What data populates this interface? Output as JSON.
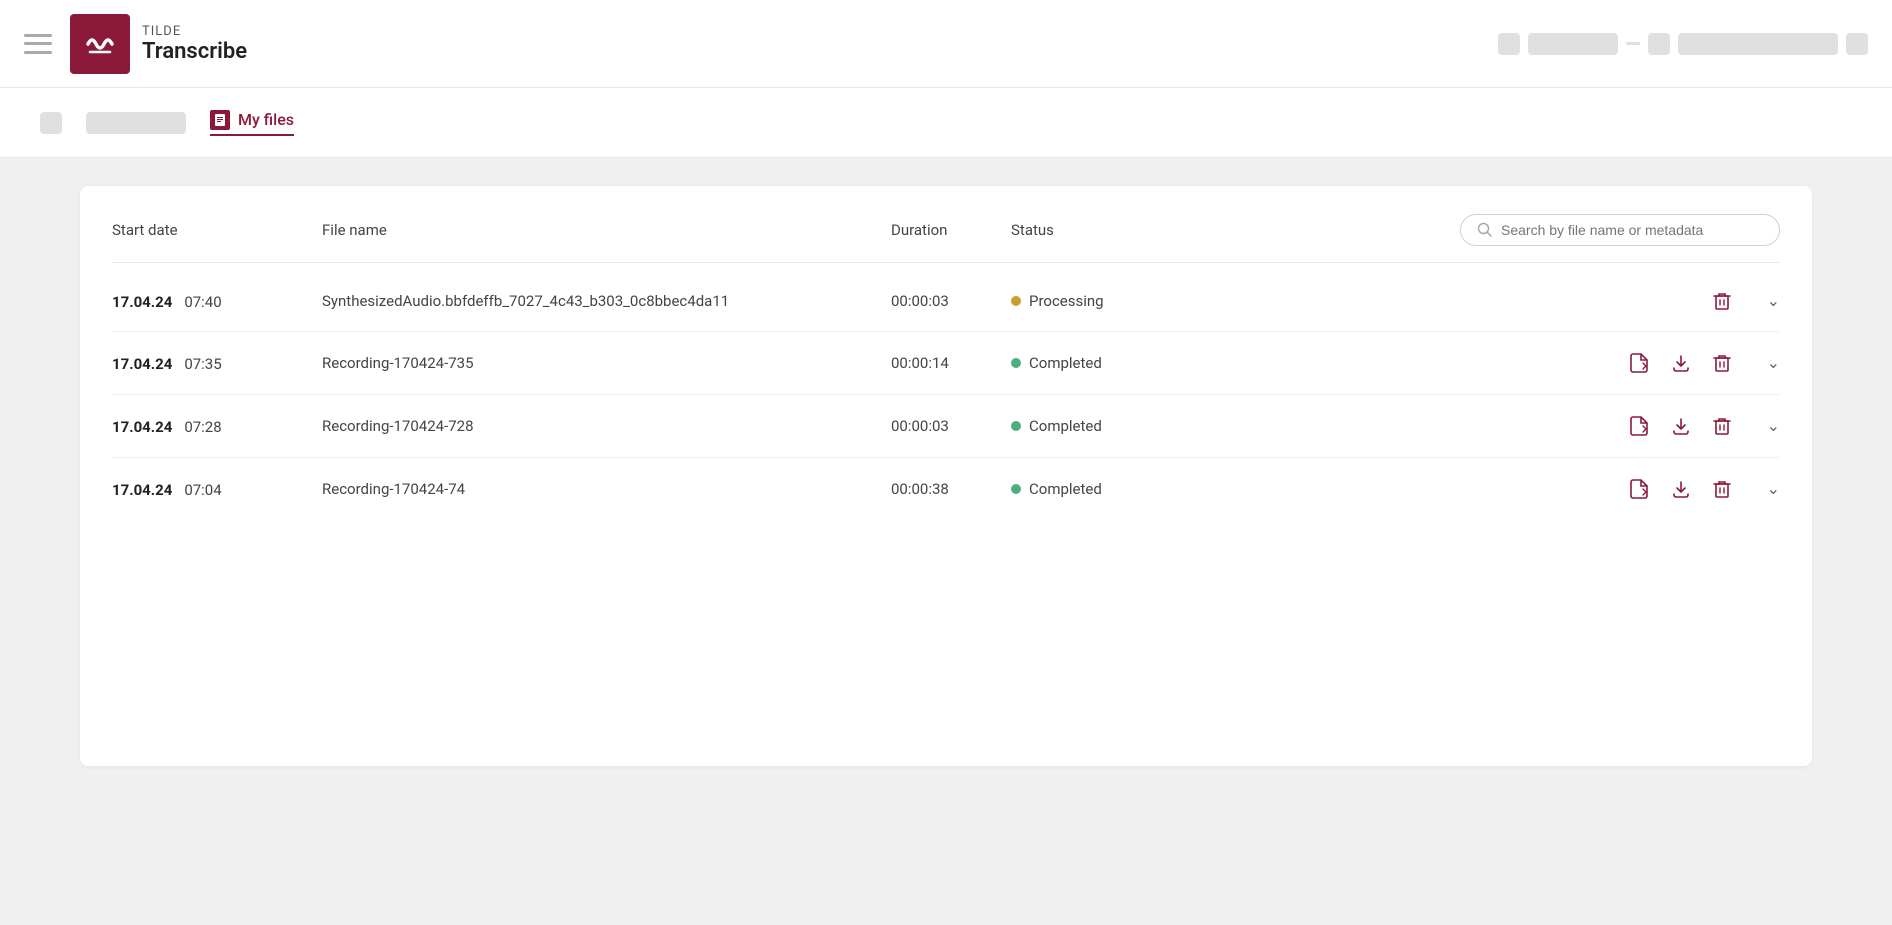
{
  "brand": {
    "name": "TILDE",
    "product": "Transcribe"
  },
  "nav": {
    "active_tab_label": "My files",
    "tab_icon_label": "files-icon"
  },
  "table": {
    "columns": {
      "start_date": "Start date",
      "file_name": "File name",
      "duration": "Duration",
      "status": "Status"
    },
    "search_placeholder": "Search by file name or metadata",
    "rows": [
      {
        "date": "17.04.24",
        "time": "07:40",
        "filename": "SynthesizedAudio.bbfdeffb_7027_4c43_b303_0c8bbec4da11",
        "duration": "00:00:03",
        "status": "Processing",
        "status_type": "processing",
        "has_doc": false,
        "has_download": false,
        "has_delete": true
      },
      {
        "date": "17.04.24",
        "time": "07:35",
        "filename": "Recording-170424-735",
        "duration": "00:00:14",
        "status": "Completed",
        "status_type": "completed",
        "has_doc": true,
        "has_download": true,
        "has_delete": true
      },
      {
        "date": "17.04.24",
        "time": "07:28",
        "filename": "Recording-170424-728",
        "duration": "00:00:03",
        "status": "Completed",
        "status_type": "completed",
        "has_doc": true,
        "has_download": true,
        "has_delete": true
      },
      {
        "date": "17.04.24",
        "time": "07:04",
        "filename": "Recording-170424-74",
        "duration": "00:00:38",
        "status": "Completed",
        "status_type": "completed",
        "has_doc": true,
        "has_download": true,
        "has_delete": true
      }
    ]
  },
  "colors": {
    "brand": "#8b1a3a",
    "processing": "#c8a02a",
    "completed": "#4caf7d"
  }
}
